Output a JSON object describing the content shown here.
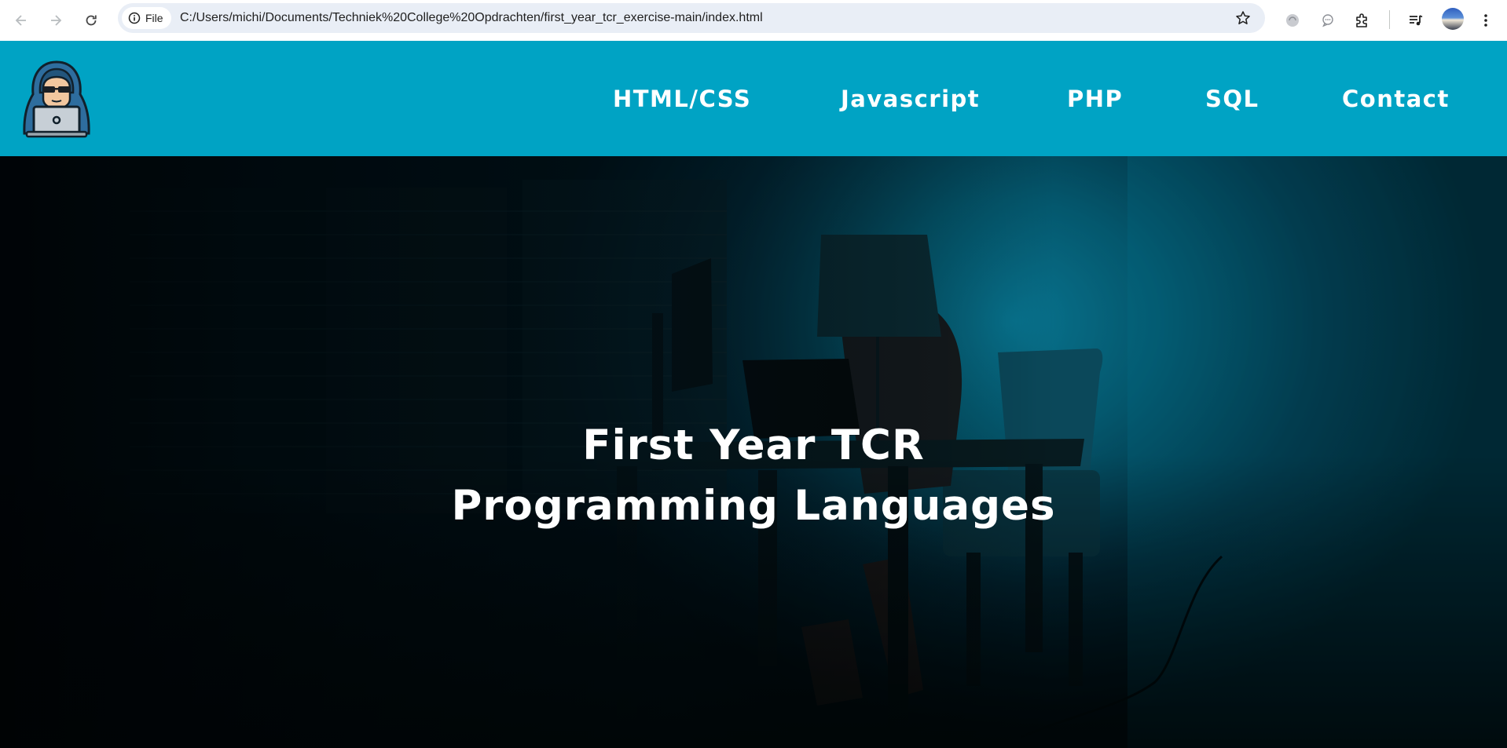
{
  "browser": {
    "scheme_chip": "File",
    "url": "C:/Users/michi/Documents/Techniek%20College%20Opdrachten/first_year_tcr_exercise-main/index.html",
    "icons": [
      "back-arrow-icon",
      "forward-arrow-icon",
      "reload-icon",
      "info-icon",
      "star-icon",
      "extension-puzzle-icon",
      "media-playlist-icon",
      "more-vertical-icon"
    ]
  },
  "header": {
    "logo_icon": "hooded-hacker-laptop-icon",
    "nav": [
      {
        "label": "HTML/CSS"
      },
      {
        "label": "Javascript"
      },
      {
        "label": "PHP"
      },
      {
        "label": "SQL"
      },
      {
        "label": "Contact"
      }
    ]
  },
  "hero": {
    "title_line1": "First Year TCR",
    "title_line2": "Programming Languages"
  },
  "colors": {
    "header_bg": "#00a3c4",
    "hero_text": "#ffffff",
    "omnibox_bg": "#e9eef6"
  }
}
